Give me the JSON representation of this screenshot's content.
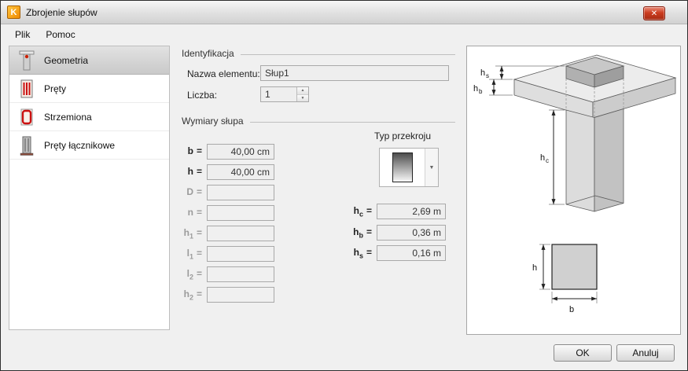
{
  "window": {
    "title": "Zbrojenie słupów"
  },
  "icons": {
    "app_letter": "K",
    "close": "✕",
    "combo_arrow": "▼",
    "spin_up": "▲",
    "spin_down": "▼"
  },
  "menu": {
    "items": [
      {
        "label": "Plik"
      },
      {
        "label": "Pomoc"
      }
    ]
  },
  "sidebar": {
    "items": [
      {
        "label": "Geometria"
      },
      {
        "label": "Pręty"
      },
      {
        "label": "Strzemiona"
      },
      {
        "label": "Pręty łącznikowe"
      }
    ]
  },
  "identification": {
    "title": "Identyfikacja",
    "name_label": "Nazwa elementu:",
    "name_value": "Słup1",
    "count_label": "Liczba:",
    "count_value": "1"
  },
  "dimensions": {
    "title": "Wymiary słupa",
    "equals": "=",
    "fields": [
      {
        "base": "b",
        "sub": "",
        "value": "40,00 cm"
      },
      {
        "base": "h",
        "sub": "",
        "value": "40,00 cm"
      },
      {
        "base": "D",
        "sub": "",
        "value": ""
      },
      {
        "base": "n",
        "sub": "",
        "value": ""
      },
      {
        "base": "h",
        "sub": "1",
        "value": ""
      },
      {
        "base": "l",
        "sub": "1",
        "value": ""
      },
      {
        "base": "l",
        "sub": "2",
        "value": ""
      },
      {
        "base": "h",
        "sub": "2",
        "value": ""
      }
    ],
    "section_type_label": "Typ przekroju",
    "heights": [
      {
        "base": "h",
        "sub": "c",
        "value": "2,69 m"
      },
      {
        "base": "h",
        "sub": "b",
        "value": "0,36 m"
      },
      {
        "base": "h",
        "sub": "s",
        "value": "0,16 m"
      }
    ]
  },
  "preview": {
    "hs_base": "h",
    "hs_sub": "s",
    "hb_base": "h",
    "hb_sub": "b",
    "hc_base": "h",
    "hc_sub": "c",
    "h_label": "h",
    "b_label": "b"
  },
  "footer": {
    "ok": "OK",
    "cancel": "Anuluj"
  }
}
